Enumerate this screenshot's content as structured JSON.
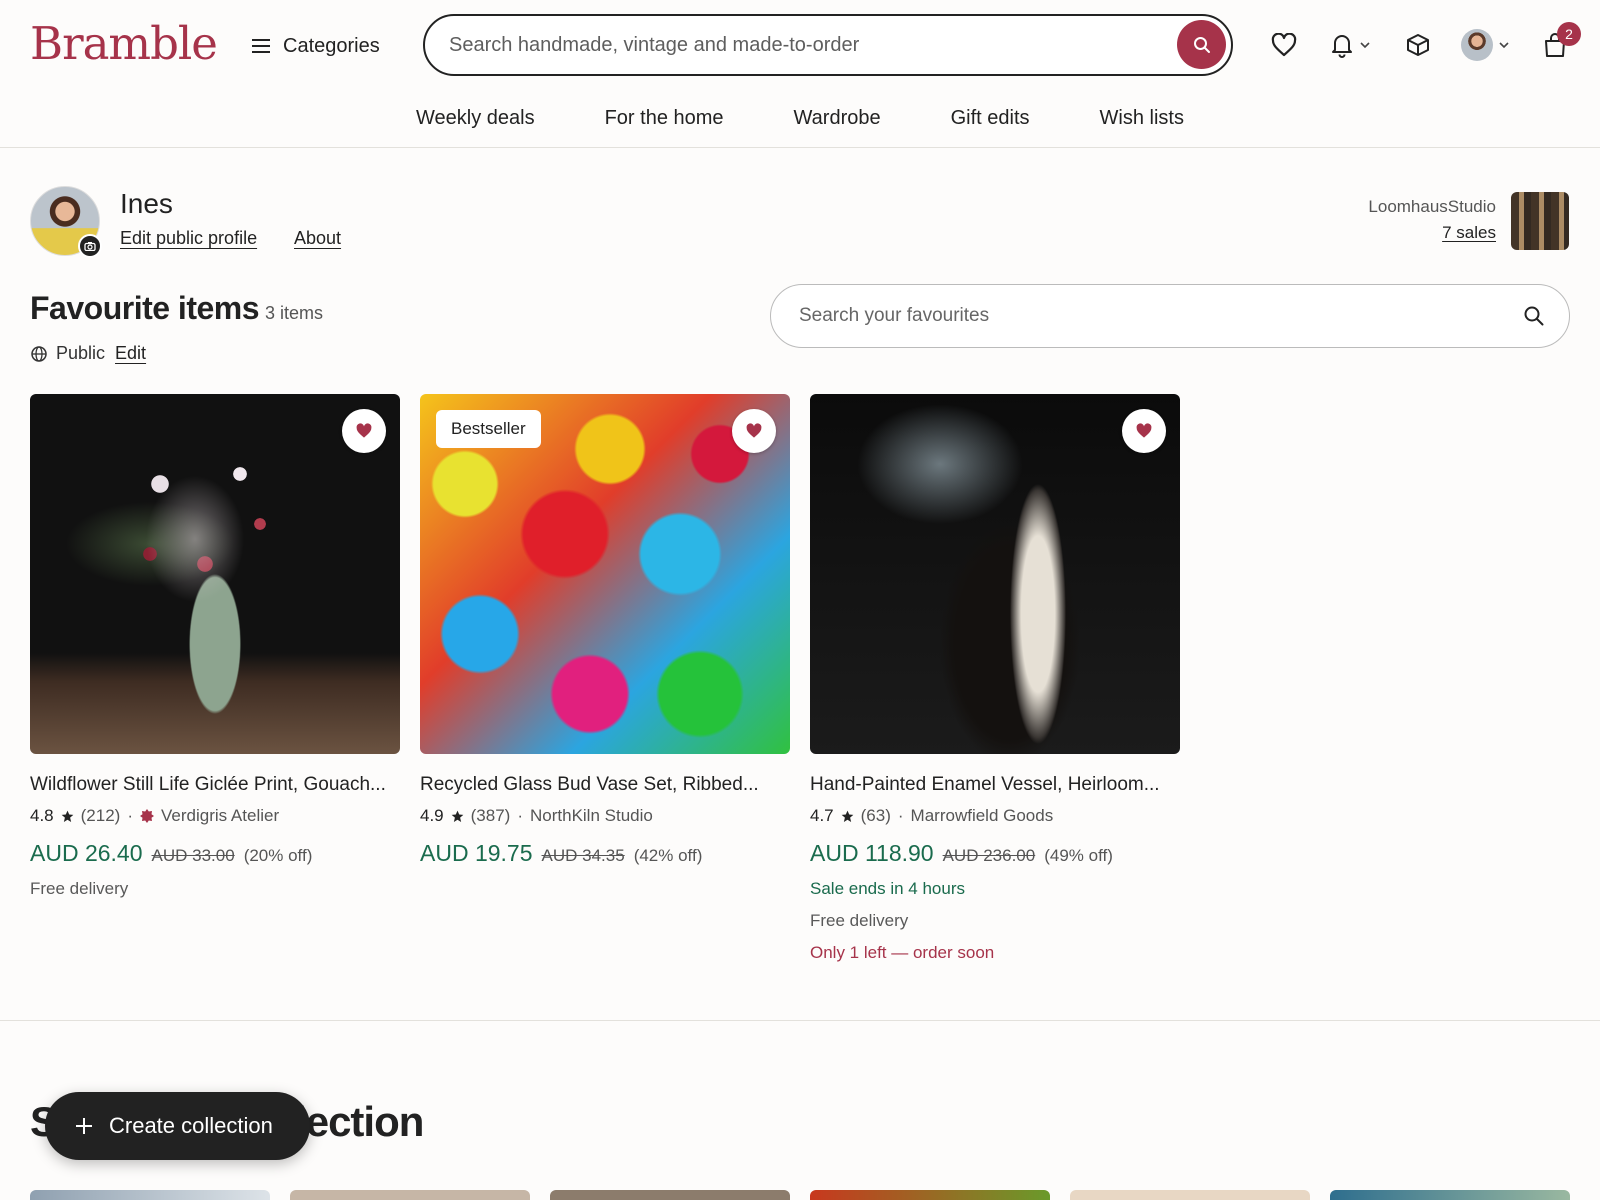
{
  "header": {
    "logo": "Bramble",
    "categories_label": "Categories",
    "search_placeholder": "Search handmade, vintage and made-to-order",
    "cart_count": "2",
    "nav": [
      "Weekly deals",
      "For the home",
      "Wardrobe",
      "Gift edits",
      "Wish lists"
    ]
  },
  "profile": {
    "name": "Ines",
    "edit_link": "Edit public profile",
    "about_link": "About",
    "shop_name": "LoomhausStudio",
    "shop_sales": "7 sales"
  },
  "favourites": {
    "title": "Favourite items",
    "count": "3 items",
    "visibility": "Public",
    "edit_label": "Edit",
    "search_placeholder": "Search your favourites",
    "items": [
      {
        "title": "Wildflower Still Life Giclée Print, Gouach...",
        "rating": "4.8",
        "reviews": "(212)",
        "shop": "Verdigris Atelier",
        "price": "AUD 26.40",
        "original_price": "AUD 33.00",
        "discount": "(20% off)",
        "delivery": "Free delivery"
      },
      {
        "badge": "Bestseller",
        "title": "Recycled Glass Bud Vase Set, Ribbed...",
        "rating": "4.9",
        "reviews": "(387)",
        "shop": "NorthKiln Studio",
        "price": "AUD 19.75",
        "original_price": "AUD 34.35",
        "discount": "(42% off)"
      },
      {
        "title": "Hand-Painted Enamel Vessel, Heirloom...",
        "rating": "4.7",
        "reviews": "(63)",
        "shop": "Marrowfield Goods",
        "price": "AUD 118.90",
        "original_price": "AUD 236.00",
        "discount": "(49% off)",
        "sale_note": "Sale ends in 4 hours",
        "delivery": "Free delivery",
        "stock_note": "Only 1 left — order soon"
      }
    ]
  },
  "collection": {
    "title": "S                   ollection",
    "create_button": "Create collection"
  },
  "colors": {
    "brand": "#a6334a",
    "price_green": "#1a6b4d",
    "text": "#222222"
  }
}
